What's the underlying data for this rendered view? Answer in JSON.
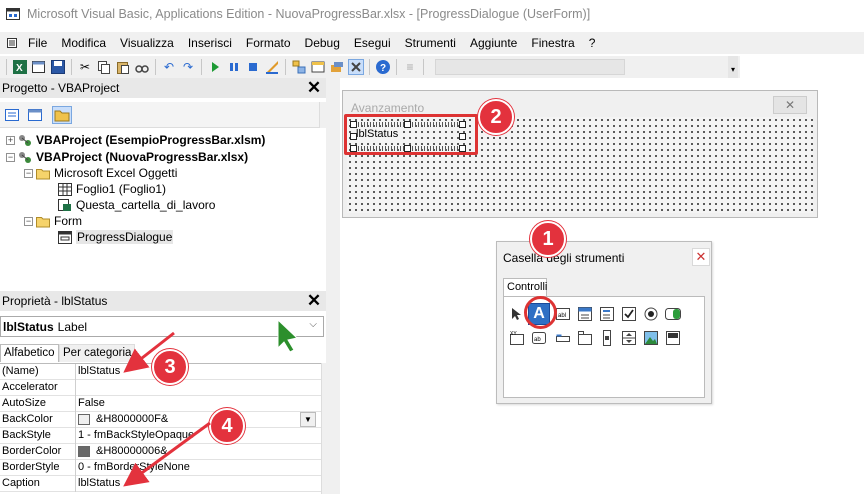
{
  "window": {
    "title": "Microsoft Visual Basic, Applications Edition - NuovaProgressBar.xlsx - [ProgressDialogue (UserForm)]"
  },
  "menu": [
    "File",
    "Modifica",
    "Visualizza",
    "Inserisci",
    "Formato",
    "Debug",
    "Esegui",
    "Strumenti",
    "Aggiunte",
    "Finestra",
    "?"
  ],
  "project": {
    "header": "Progetto - VBAProject",
    "nodes": [
      {
        "label": "VBAProject (EsempioProgressBar.xlsm)"
      },
      {
        "label": "VBAProject (NuovaProgressBar.xlsx)"
      },
      {
        "label": "Microsoft Excel Oggetti"
      },
      {
        "label": "Foglio1 (Foglio1)"
      },
      {
        "label": "Questa_cartella_di_lavoro"
      },
      {
        "label": "Form"
      },
      {
        "label": "ProgressDialogue"
      }
    ]
  },
  "properties": {
    "header": "Proprietà - lblStatus",
    "object_name": "lblStatus",
    "object_type": "Label",
    "tab_alpha": "Alfabetico",
    "tab_cat": "Per categoria",
    "rows": [
      {
        "name": "(Name)",
        "value": "lblStatus"
      },
      {
        "name": "Accelerator",
        "value": ""
      },
      {
        "name": "AutoSize",
        "value": "False"
      },
      {
        "name": "BackColor",
        "value": "&H8000000F&",
        "swatch": "#f0f0f0"
      },
      {
        "name": "BackStyle",
        "value": "1 - fmBackStyleOpaque"
      },
      {
        "name": "BorderColor",
        "value": "&H80000006&",
        "swatch": "#696969"
      },
      {
        "name": "BorderStyle",
        "value": "0 - fmBorderStyleNone"
      },
      {
        "name": "Caption",
        "value": "lblStatus"
      }
    ]
  },
  "userform": {
    "title": "Avanzamento",
    "label_caption": "lblStatus"
  },
  "toolbox": {
    "title": "Casella degli strumenti",
    "tab": "Controlli"
  },
  "badges": [
    "1",
    "2",
    "3",
    "4"
  ],
  "colors": {
    "badge": "#e3323d",
    "highlight": "#d33333",
    "selected_tool": "#2f6fc4"
  }
}
